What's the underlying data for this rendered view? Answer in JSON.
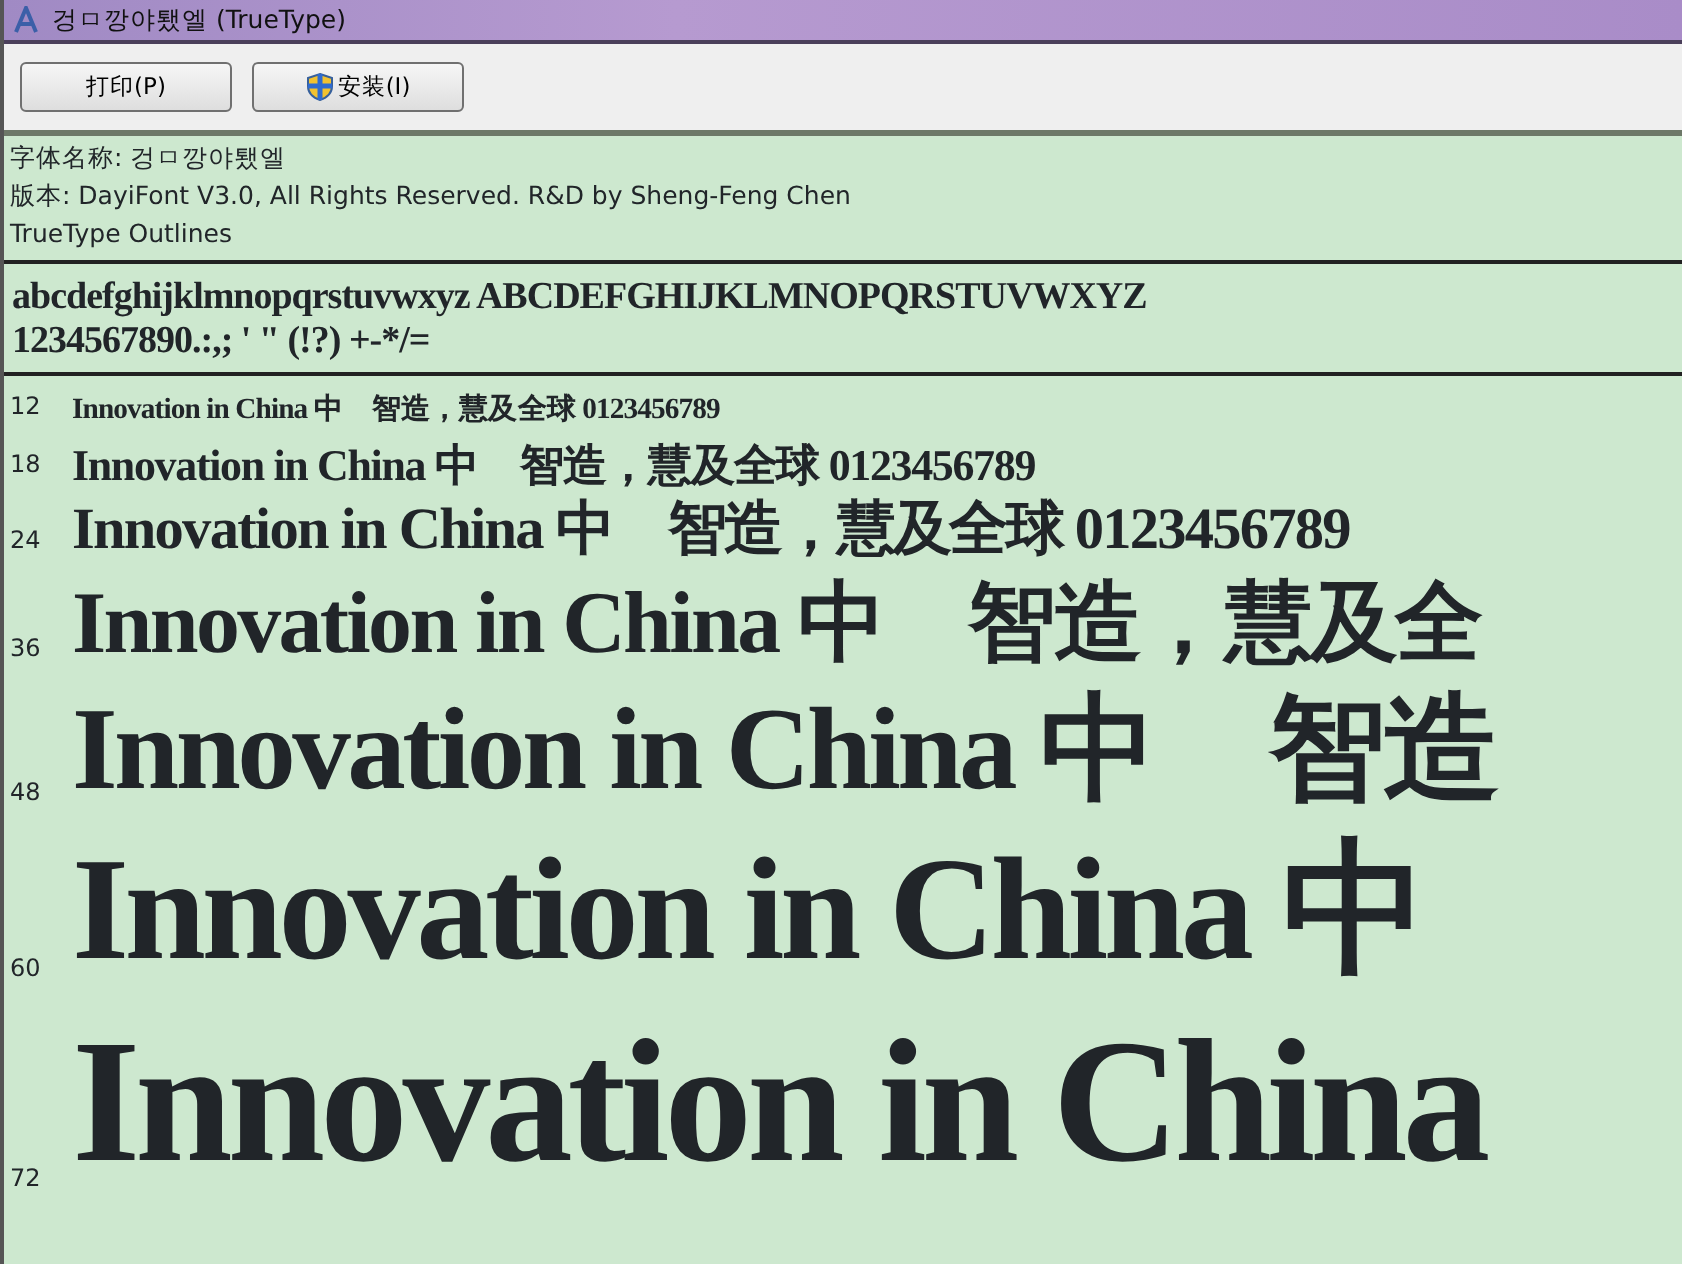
{
  "window": {
    "title": "겅ㅁ깡야퇬엘 (TrueType)"
  },
  "toolbar": {
    "buttons": [
      {
        "label": "打印(P)",
        "kind": "plain"
      },
      {
        "label": "安装(I)",
        "kind": "shield"
      }
    ]
  },
  "info": {
    "font_name_label": "字体名称:",
    "font_name": "겅ㅁ깡야퇬엘",
    "version_label": "版本:",
    "version": "DayiFont V3.0, All Rights Reserved. R&D by Sheng-Feng Chen",
    "type": "TrueType Outlines"
  },
  "character_set": [
    "abcdefghijklmnopqrstuvwxyz ABCDEFGHIJKLMNOPQRSTUVWXYZ",
    "1234567890.:,; ' \" (!?) +-*/="
  ],
  "samples": [
    {
      "size": "12",
      "text": "Innovation in China 中　智造，慧及全球 0123456789"
    },
    {
      "size": "18",
      "text": "Innovation in China 中　智造，慧及全球 0123456789"
    },
    {
      "size": "24",
      "text": "Innovation in China 中　智造，慧及全球 0123456789"
    },
    {
      "size": "36",
      "text": "Innovation in China 中　智造，慧及全"
    },
    {
      "size": "48",
      "text": "Innovation in China 中　智造"
    },
    {
      "size": "60",
      "text": "Innovation in China 中"
    },
    {
      "size": "72",
      "text": "Innovation in China"
    }
  ]
}
